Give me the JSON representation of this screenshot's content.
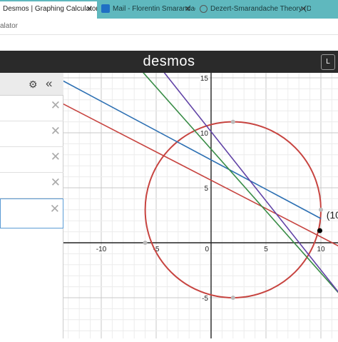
{
  "browser": {
    "tabs": [
      {
        "label": "Desmos | Graphing Calculator",
        "active": true
      },
      {
        "label": "Mail - Florentin Smarandache - O",
        "active": false
      },
      {
        "label": "Dezert-Smarandache Theory (DS",
        "active": false
      }
    ],
    "address_text": "alator"
  },
  "app": {
    "logo": "desmos",
    "header_button": "L"
  },
  "expressions": {
    "rows": 5,
    "active_row": 4
  },
  "graph": {
    "x_ticks": [
      "-10",
      "-5",
      "0",
      "5",
      "10"
    ],
    "y_ticks": [
      "15",
      "10",
      "5",
      "-5"
    ],
    "point_label": "(10",
    "colors": {
      "red": "#c74440",
      "blue": "#2d70b3",
      "green": "#388c46",
      "purple": "#6042a6",
      "axis": "#222"
    }
  }
}
